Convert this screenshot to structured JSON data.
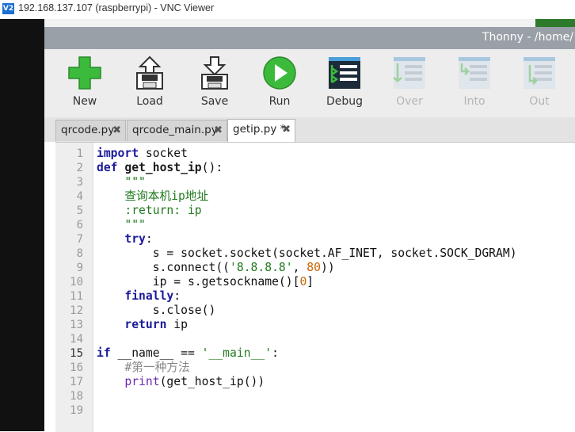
{
  "vnc": {
    "title": "192.168.137.107 (raspberrypi) - VNC Viewer",
    "logo": "V2"
  },
  "window": {
    "title": "Thonny  -  /home/"
  },
  "toolbar": [
    {
      "label": "New",
      "icon": "new-file-plus-icon",
      "enabled": true
    },
    {
      "label": "Load",
      "icon": "load-floppy-icon",
      "enabled": true
    },
    {
      "label": "Save",
      "icon": "save-floppy-icon",
      "enabled": true
    },
    {
      "label": "Run",
      "icon": "run-play-icon",
      "enabled": true
    },
    {
      "label": "Debug",
      "icon": "debug-icon",
      "enabled": true
    },
    {
      "label": "Over",
      "icon": "step-over-icon",
      "enabled": false
    },
    {
      "label": "Into",
      "icon": "step-into-icon",
      "enabled": false
    },
    {
      "label": "Out",
      "icon": "step-out-icon",
      "enabled": false
    }
  ],
  "tabs": [
    {
      "label": "qrcode.py",
      "close": "✖",
      "active": false
    },
    {
      "label": "qrcode_main.py",
      "close": "✖",
      "active": false
    },
    {
      "label": "getip.py *",
      "close": "✖",
      "active": true
    }
  ],
  "editor": {
    "current_line": 15,
    "line_numbers": [
      "1",
      "2",
      "3",
      "4",
      "5",
      "6",
      "7",
      "8",
      "9",
      "10",
      "11",
      "12",
      "13",
      "14",
      "15",
      "16",
      "17",
      "18",
      "19"
    ],
    "lines": [
      "import socket",
      "def get_host_ip():",
      "    \"\"\"",
      "    查询本机ip地址",
      "    :return: ip",
      "    \"\"\"",
      "    try:",
      "        s = socket.socket(socket.AF_INET, socket.SOCK_DGRAM)",
      "        s.connect(('8.8.8.8', 80))",
      "        ip = s.getsockname()[0]",
      "    finally:",
      "        s.close()",
      "    return ip",
      "",
      "if __name__ == '__main__':",
      "    #第一种方法",
      "    print(get_host_ip())",
      "",
      ""
    ]
  },
  "colors": {
    "accent_green": "#3cba3c",
    "title_bar": "#9aa0a7",
    "keyword": "#1a1a9a",
    "string": "#1f7a1f",
    "number": "#c86400"
  }
}
